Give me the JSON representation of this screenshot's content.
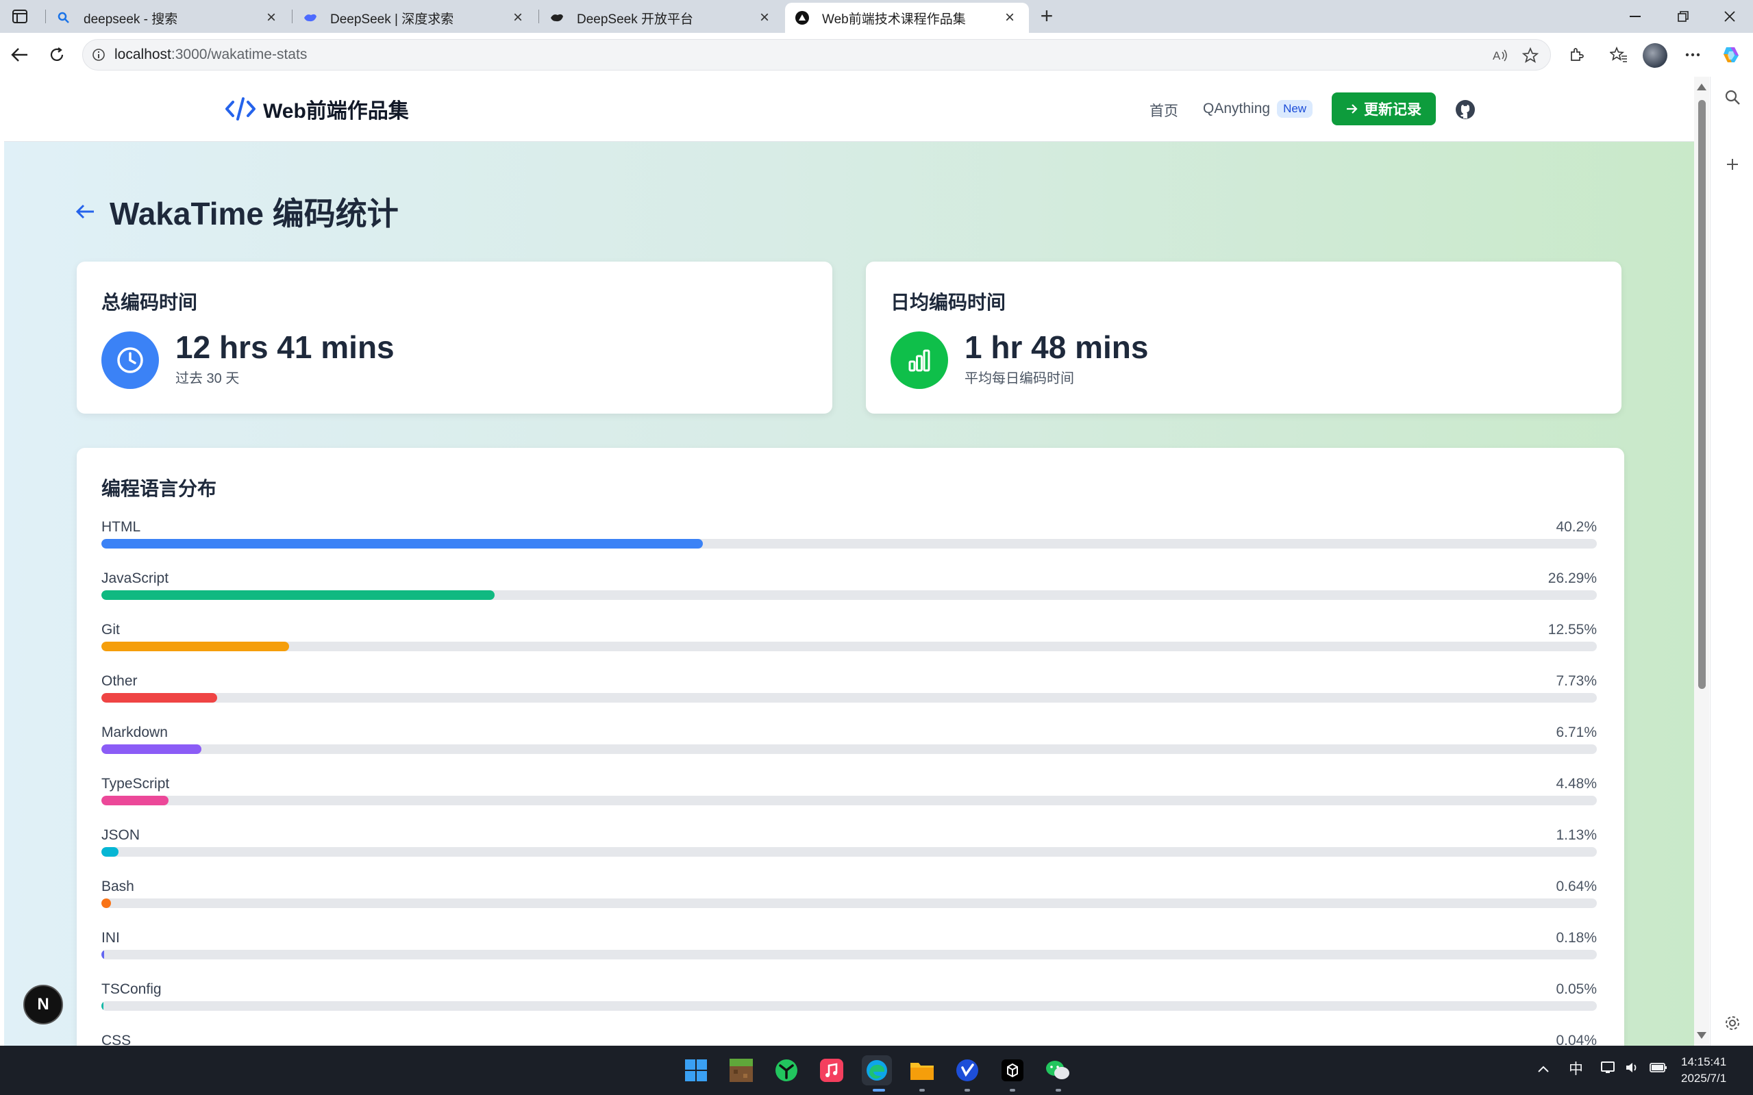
{
  "browser": {
    "tabs": [
      {
        "title": "deepseek - 搜索",
        "icon": "search-favicon"
      },
      {
        "title": "DeepSeek | 深度求索",
        "icon": "deepseek-favicon"
      },
      {
        "title": "DeepSeek 开放平台",
        "icon": "deepseek-favicon"
      },
      {
        "title": "Web前端技术课程作品集",
        "icon": "triangle-favicon",
        "active": true
      }
    ],
    "url_host": "localhost",
    "url_path": ":3000/wakatime-stats"
  },
  "site": {
    "brand": "Web前端作品集",
    "nav": {
      "home": "首页",
      "qanything": "QAnything",
      "new_badge": "New",
      "update_button": "更新记录"
    }
  },
  "page": {
    "title": "WakaTime 编码统计",
    "total": {
      "label": "总编码时间",
      "value": "12 hrs 41 mins",
      "sub": "过去 30 天",
      "color": "#3b82f6"
    },
    "daily": {
      "label": "日均编码时间",
      "value": "1 hr 48 mins",
      "sub": "平均每日编码时间",
      "color": "#0fbf4a"
    },
    "languages_title": "编程语言分布",
    "languages": [
      {
        "name": "HTML",
        "pct_label": "40.2%",
        "pct": 40.2,
        "color": "#3b82f6"
      },
      {
        "name": "JavaScript",
        "pct_label": "26.29%",
        "pct": 26.29,
        "color": "#10b981"
      },
      {
        "name": "Git",
        "pct_label": "12.55%",
        "pct": 12.55,
        "color": "#f59e0b"
      },
      {
        "name": "Other",
        "pct_label": "7.73%",
        "pct": 7.73,
        "color": "#ef4444"
      },
      {
        "name": "Markdown",
        "pct_label": "6.71%",
        "pct": 6.71,
        "color": "#8b5cf6"
      },
      {
        "name": "TypeScript",
        "pct_label": "4.48%",
        "pct": 4.48,
        "color": "#ec4899"
      },
      {
        "name": "JSON",
        "pct_label": "1.13%",
        "pct": 1.13,
        "color": "#06b6d4"
      },
      {
        "name": "Bash",
        "pct_label": "0.64%",
        "pct": 0.64,
        "color": "#f97316"
      },
      {
        "name": "INI",
        "pct_label": "0.18%",
        "pct": 0.18,
        "color": "#6366f1"
      },
      {
        "name": "TSConfig",
        "pct_label": "0.05%",
        "pct": 0.05,
        "color": "#14b8a6"
      },
      {
        "name": "CSS",
        "pct_label": "0.04%",
        "pct": 0.04,
        "color": "#a855f7"
      }
    ]
  },
  "overlay": {
    "next_badge": "N"
  },
  "taskbar": {
    "tray_ime": "中",
    "time": "14:15:41",
    "date": "2025/7/1"
  }
}
